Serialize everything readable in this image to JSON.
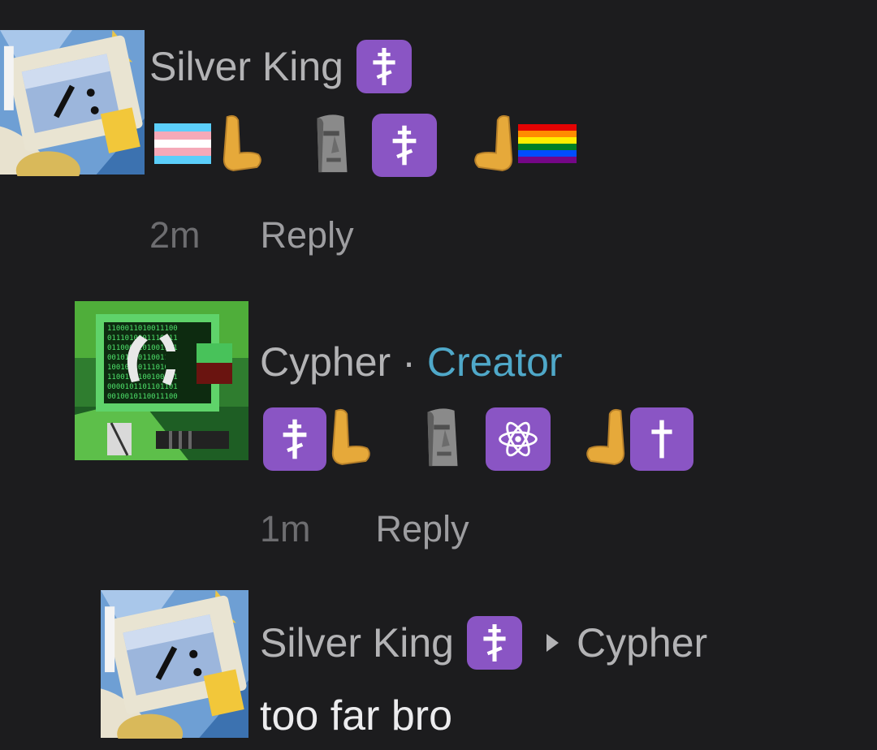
{
  "comments": [
    {
      "author": "Silver King",
      "author_badge_icon": "orthodox-cross-icon",
      "emojis": [
        "transgender-flag-icon",
        "left-hand-icon",
        "moai-icon",
        "orthodox-cross-icon",
        "right-hand-icon",
        "rainbow-flag-icon"
      ],
      "time": "2m",
      "reply_label": "Reply"
    },
    {
      "author": "Cypher",
      "separator": "·",
      "role": "Creator",
      "emojis": [
        "orthodox-cross-icon",
        "left-hand-icon",
        "moai-icon",
        "atom-symbol-icon",
        "right-hand-icon",
        "latin-cross-icon"
      ],
      "time": "1m",
      "reply_label": "Reply"
    },
    {
      "author": "Silver King",
      "author_badge_icon": "orthodox-cross-icon",
      "reply_to_icon": "triangle-right-icon",
      "reply_to": "Cypher",
      "text": "too far bro"
    }
  ],
  "colors": {
    "background": "#1c1c1e",
    "name": "#b3b3b5",
    "creator": "#4fa8c9",
    "emoji_chip": "#8a55c4",
    "hand": "#e6a93a",
    "moai": "#7f7f7f"
  }
}
